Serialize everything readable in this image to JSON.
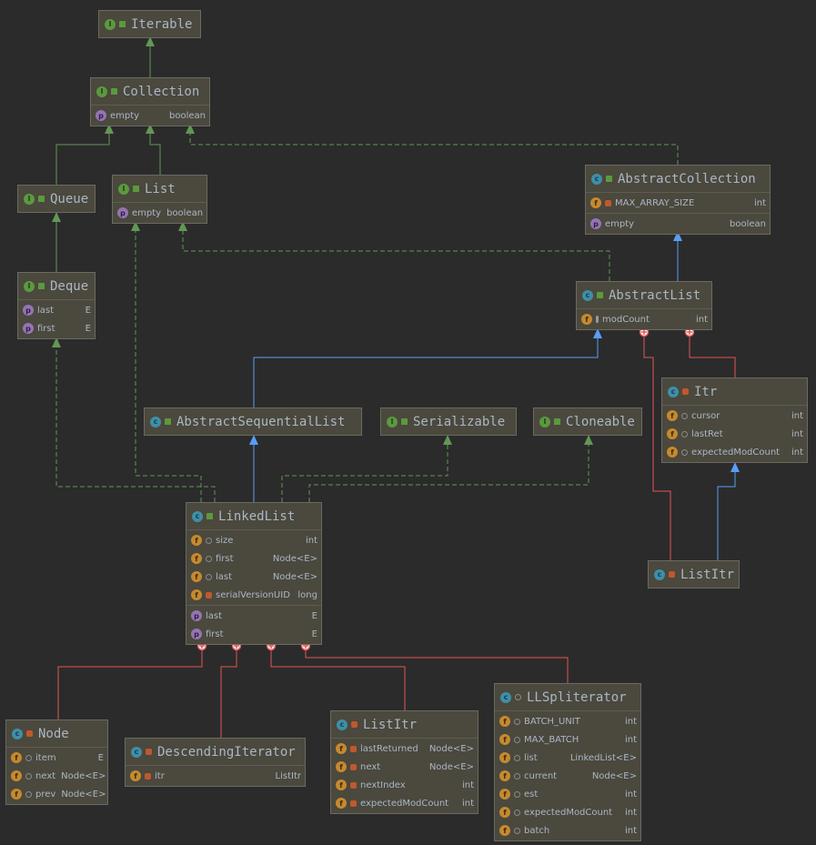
{
  "colors": {
    "background": "#2b2b2b",
    "interface_inheritance": "#629755",
    "class_inheritance": "#589df6",
    "inner_class": "#e05555"
  },
  "boxes": {
    "iterable": {
      "title": "Iterable",
      "kind": "interface",
      "visibility": "public",
      "sections": []
    },
    "collection": {
      "title": "Collection",
      "kind": "interface",
      "visibility": "public",
      "sections": [
        [
          {
            "icon": "property",
            "vis": "none",
            "name": "empty",
            "type": "boolean"
          }
        ]
      ]
    },
    "queue": {
      "title": "Queue",
      "kind": "interface",
      "visibility": "public",
      "sections": []
    },
    "list": {
      "title": "List",
      "kind": "interface",
      "visibility": "public",
      "sections": [
        [
          {
            "icon": "property",
            "vis": "none",
            "name": "empty",
            "type": "boolean"
          }
        ]
      ]
    },
    "deque": {
      "title": "Deque",
      "kind": "interface",
      "visibility": "public",
      "sections": [
        [
          {
            "icon": "property",
            "vis": "none",
            "name": "last",
            "type": "E"
          },
          {
            "icon": "property",
            "vis": "none",
            "name": "first",
            "type": "E"
          }
        ]
      ]
    },
    "abstract_collection": {
      "title": "AbstractCollection",
      "kind": "class",
      "visibility": "public",
      "sections": [
        [
          {
            "icon": "field",
            "vis": "private",
            "name": "MAX_ARRAY_SIZE",
            "type": "int"
          }
        ],
        [
          {
            "icon": "property",
            "vis": "none",
            "name": "empty",
            "type": "boolean"
          }
        ]
      ]
    },
    "abstract_list": {
      "title": "AbstractList",
      "kind": "class",
      "visibility": "public",
      "sections": [
        [
          {
            "icon": "field",
            "vis": "protected",
            "name": "modCount",
            "type": "int"
          }
        ]
      ]
    },
    "abstract_sequential_list": {
      "title": "AbstractSequentialList",
      "kind": "class",
      "visibility": "public",
      "sections": []
    },
    "serializable": {
      "title": "Serializable",
      "kind": "interface",
      "visibility": "public",
      "sections": []
    },
    "cloneable": {
      "title": "Cloneable",
      "kind": "interface",
      "visibility": "public",
      "sections": []
    },
    "itr": {
      "title": "Itr",
      "kind": "class",
      "visibility": "private",
      "sections": [
        [
          {
            "icon": "field",
            "vis": "package",
            "name": "cursor",
            "type": "int"
          },
          {
            "icon": "field",
            "vis": "package",
            "name": "lastRet",
            "type": "int"
          },
          {
            "icon": "field",
            "vis": "package",
            "name": "expectedModCount",
            "type": "int"
          }
        ]
      ]
    },
    "linked_list": {
      "title": "LinkedList",
      "kind": "class",
      "visibility": "public",
      "sections": [
        [
          {
            "icon": "field",
            "vis": "package",
            "name": "size",
            "type": "int"
          },
          {
            "icon": "field",
            "vis": "package",
            "name": "first",
            "type": "Node<E>"
          },
          {
            "icon": "field",
            "vis": "package",
            "name": "last",
            "type": "Node<E>"
          },
          {
            "icon": "field",
            "vis": "private",
            "name": "serialVersionUID",
            "type": "long"
          }
        ],
        [
          {
            "icon": "property",
            "vis": "none",
            "name": "last",
            "type": "E"
          },
          {
            "icon": "property",
            "vis": "none",
            "name": "first",
            "type": "E"
          }
        ]
      ]
    },
    "list_itr_abstract": {
      "title": "ListItr",
      "kind": "class",
      "visibility": "private",
      "sections": []
    },
    "node": {
      "title": "Node",
      "kind": "class",
      "visibility": "private",
      "sections": [
        [
          {
            "icon": "field",
            "vis": "package",
            "name": "item",
            "type": "E"
          },
          {
            "icon": "field",
            "vis": "package",
            "name": "next",
            "type": "Node<E>"
          },
          {
            "icon": "field",
            "vis": "package",
            "name": "prev",
            "type": "Node<E>"
          }
        ]
      ]
    },
    "descending_iterator": {
      "title": "DescendingIterator",
      "kind": "class",
      "visibility": "private",
      "sections": [
        [
          {
            "icon": "field",
            "vis": "private",
            "name": "itr",
            "type": "ListItr"
          }
        ]
      ]
    },
    "list_itr": {
      "title": "ListItr",
      "kind": "class",
      "visibility": "private",
      "sections": [
        [
          {
            "icon": "field",
            "vis": "private",
            "name": "lastReturned",
            "type": "Node<E>"
          },
          {
            "icon": "field",
            "vis": "private",
            "name": "next",
            "type": "Node<E>"
          },
          {
            "icon": "field",
            "vis": "private",
            "name": "nextIndex",
            "type": "int"
          },
          {
            "icon": "field",
            "vis": "private",
            "name": "expectedModCount",
            "type": "int"
          }
        ]
      ]
    },
    "ll_spliterator": {
      "title": "LLSpliterator",
      "kind": "class",
      "visibility": "package",
      "sections": [
        [
          {
            "icon": "field",
            "vis": "package",
            "name": "BATCH_UNIT",
            "type": "int"
          },
          {
            "icon": "field",
            "vis": "package",
            "name": "MAX_BATCH",
            "type": "int"
          },
          {
            "icon": "field",
            "vis": "package",
            "name": "list",
            "type": "LinkedList<E>"
          },
          {
            "icon": "field",
            "vis": "package",
            "name": "current",
            "type": "Node<E>"
          },
          {
            "icon": "field",
            "vis": "package",
            "name": "est",
            "type": "int"
          },
          {
            "icon": "field",
            "vis": "package",
            "name": "expectedModCount",
            "type": "int"
          },
          {
            "icon": "field",
            "vis": "package",
            "name": "batch",
            "type": "int"
          }
        ]
      ]
    }
  }
}
